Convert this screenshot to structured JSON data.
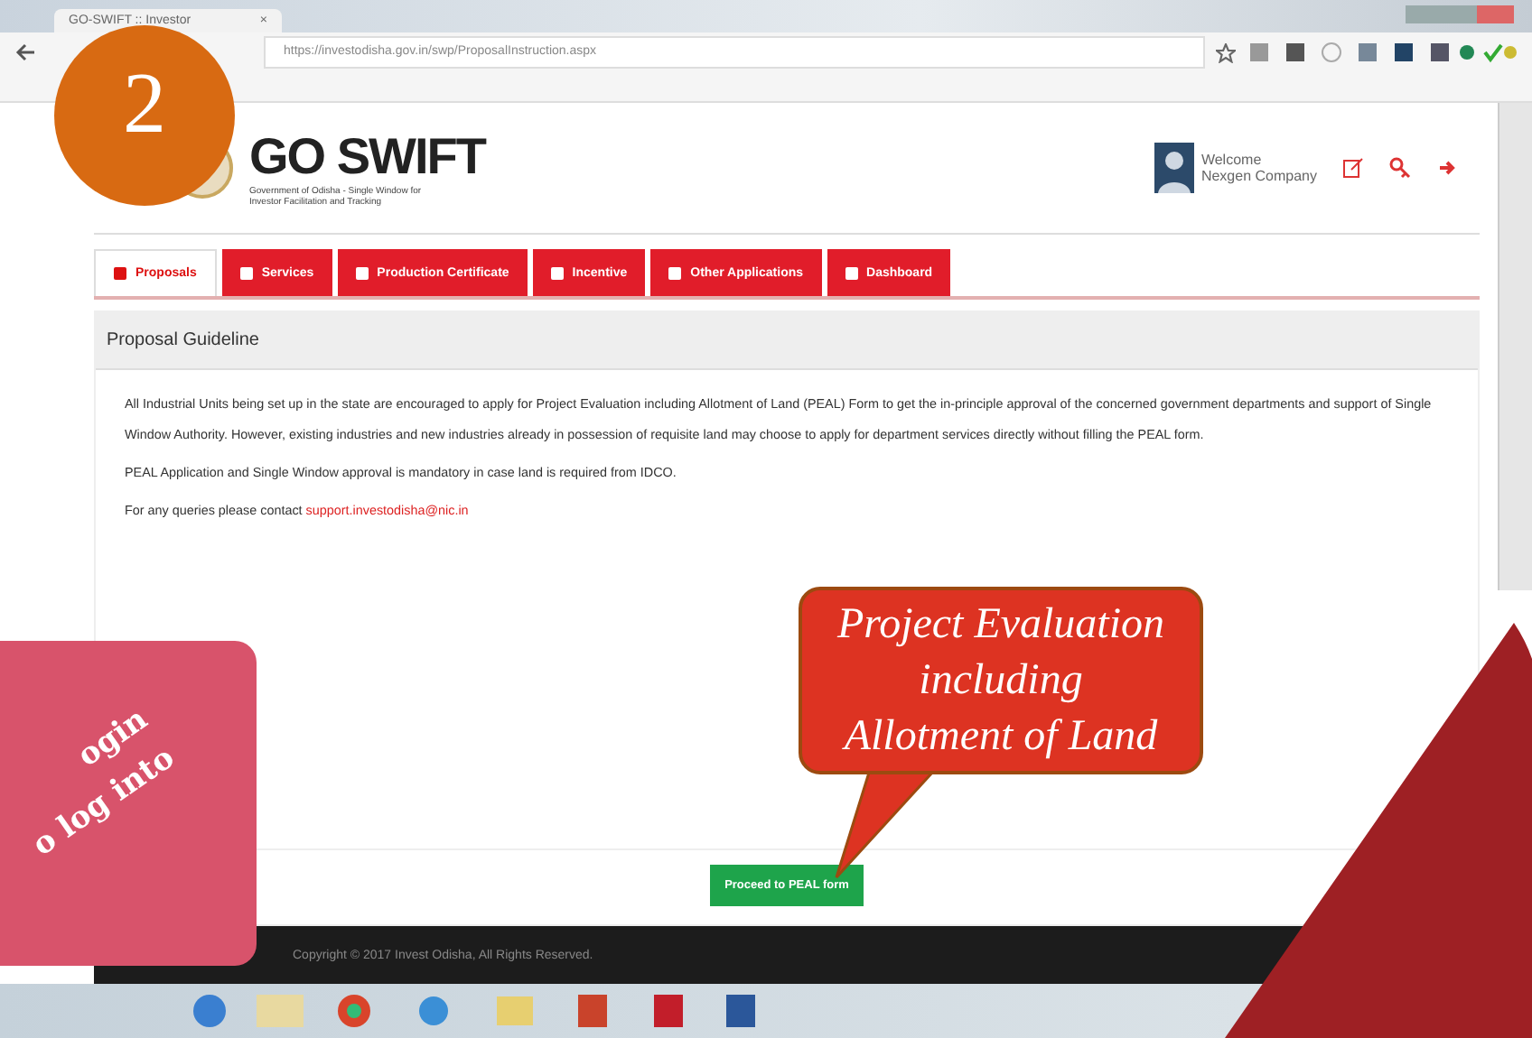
{
  "browser": {
    "tab_title": "GO-SWIFT :: Investor",
    "close": "×",
    "url": "https://investodisha.gov.in/swp/ProposalInstruction.aspx"
  },
  "header": {
    "logo": "GO SWIFT",
    "logo_subtitle": "Government of Odisha - Single Window for Investor Facilitation and Tracking",
    "welcome": "Welcome",
    "company": "Nexgen Company"
  },
  "tabs": [
    {
      "label": "Proposals",
      "selected": true
    },
    {
      "label": "Services",
      "selected": false
    },
    {
      "label": "Production Certificate",
      "selected": false
    },
    {
      "label": "Incentive",
      "selected": false
    },
    {
      "label": "Other Applications",
      "selected": false
    },
    {
      "label": "Dashboard",
      "selected": false
    }
  ],
  "panel": {
    "title": "Proposal Guideline",
    "paragraphs": [
      "All Industrial Units being set up in the state are encouraged to apply for Project Evaluation including Allotment of Land (PEAL) Form to get the in-principle approval of the concerned government departments and support of Single Window Authority. However, existing industries and new industries already in possession of requisite land may choose to apply for department services directly without filling the PEAL form.",
      "PEAL Application and Single Window approval is mandatory in case land is required from IDCO."
    ],
    "contact_text": "For any queries please contact",
    "contact_email": "support.investodisha@nic.in",
    "button": "Proceed to PEAL form"
  },
  "footer": "Copyright © 2017 Invest Odisha, All Rights Reserved.",
  "overlay": {
    "step": "2",
    "callout": [
      "Project Evaluation",
      "including",
      "Allotment of Land"
    ],
    "side_note": [
      "ogin",
      "o log into"
    ]
  }
}
